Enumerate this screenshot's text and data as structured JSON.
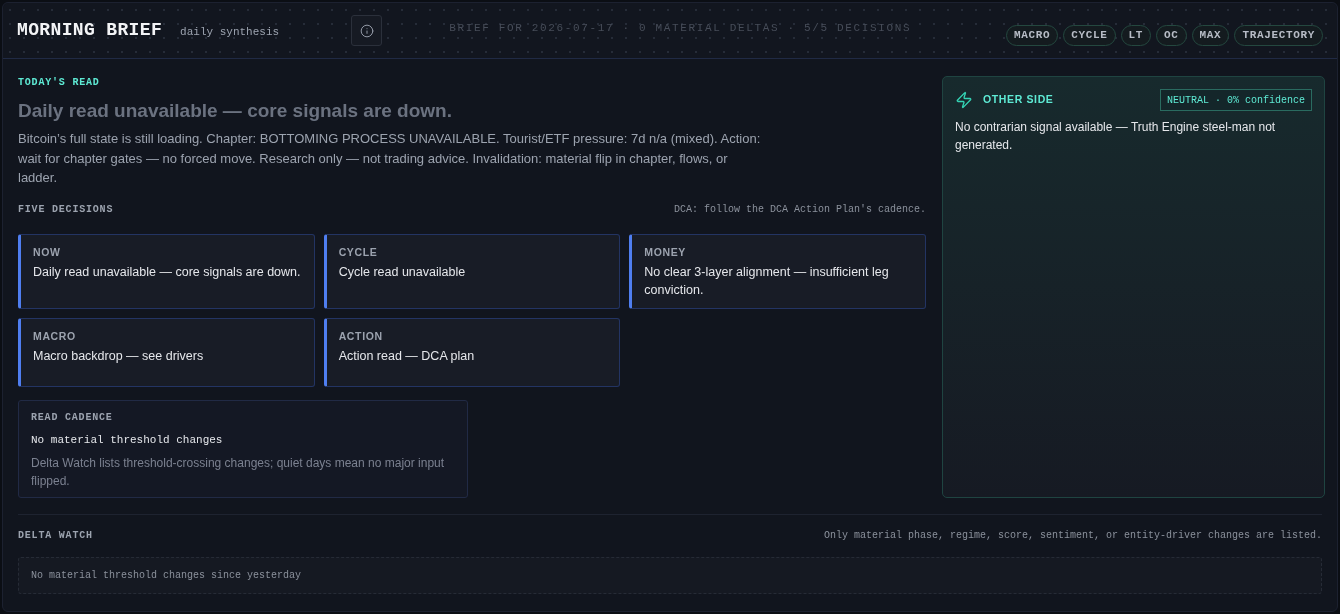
{
  "header": {
    "title": "MORNING BRIEF",
    "subtitle": "daily synthesis",
    "summary": "BRIEF FOR 2026-07-17 · 0 MATERIAL DELTAS · 5/5 DECISIONS",
    "chips": [
      {
        "label": "MACRO"
      },
      {
        "label": "CYCLE"
      },
      {
        "label": "LT"
      },
      {
        "label": "OC"
      },
      {
        "label": "MAX"
      },
      {
        "label": "TRAJECTORY"
      }
    ]
  },
  "todays_read": {
    "eyebrow": "TODAY'S READ",
    "headline": "Daily read unavailable — core signals are down.",
    "body": "Bitcoin’s full state is still loading. Chapter: BOTTOMING PROCESS UNAVAILABLE. Tourist/ETF pressure: 7d n/a (mixed). Action: wait for chapter gates — no forced move. Research only — not trading advice. Invalidation: material flip in chapter, flows, or ladder."
  },
  "five_decisions": {
    "title": "FIVE DECISIONS",
    "note": "DCA: follow the DCA Action Plan's cadence.",
    "cards": [
      {
        "label": "NOW",
        "text": "Daily read unavailable — core signals are down."
      },
      {
        "label": "CYCLE",
        "text": "Cycle read unavailable"
      },
      {
        "label": "MONEY",
        "text": "No clear 3-layer alignment — insufficient leg conviction."
      },
      {
        "label": "MACRO",
        "text": "Macro backdrop — see drivers"
      },
      {
        "label": "ACTION",
        "text": "Action read — DCA plan"
      }
    ]
  },
  "read_cadence": {
    "title": "READ CADENCE",
    "headline": "No material threshold changes",
    "body": "Delta Watch lists threshold-crossing changes; quiet days mean no major input flipped."
  },
  "other_side": {
    "title": "OTHER SIDE",
    "badge": "NEUTRAL · 0% confidence",
    "text": "No contrarian signal available — Truth Engine steel-man not generated."
  },
  "delta_watch": {
    "title": "DELTA WATCH",
    "note": "Only material phase, regime, score, sentiment, or entity-driver changes are listed.",
    "empty_message": "No material threshold changes since yesterday"
  }
}
